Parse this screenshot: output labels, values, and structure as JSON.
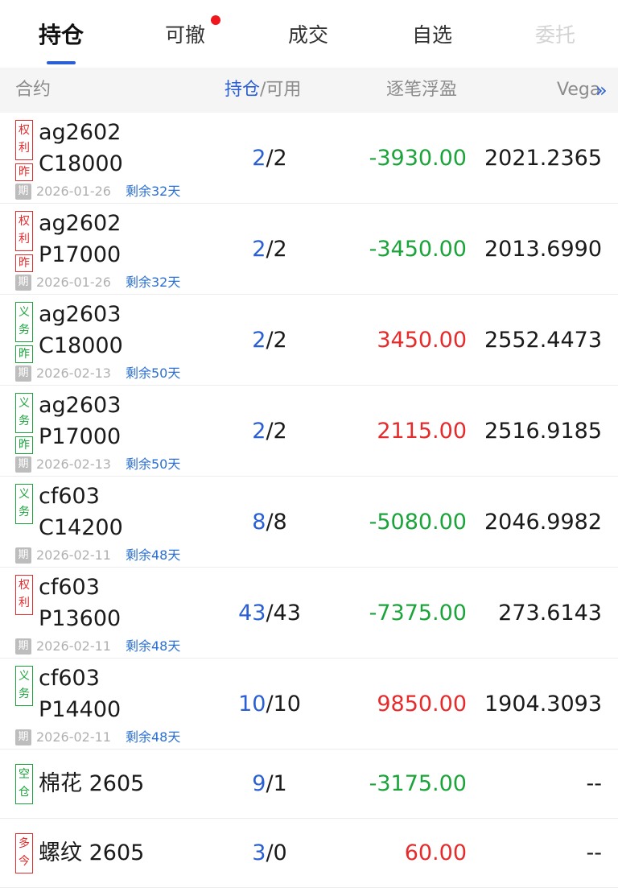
{
  "tabs": [
    {
      "label": "持仓",
      "active": true
    },
    {
      "label": "可撤",
      "badge": true
    },
    {
      "label": "成交"
    },
    {
      "label": "自选"
    },
    {
      "label": "委托",
      "faded": true
    }
  ],
  "header": {
    "contract": "合约",
    "held": "持仓",
    "sep_available": "/可用",
    "pnl": "逐笔浮盈",
    "vega": "Vega",
    "more_icon": "double-chevron-right-icon"
  },
  "colors": {
    "accent": "#2a5fd6",
    "loss": "#1aa43a",
    "gain": "#e52b2b",
    "badge": "#f0161e"
  },
  "rows": [
    {
      "tag1": "权利",
      "tag2": "昨",
      "tagColor": "red",
      "line1": "ag2602",
      "line2": "C18000",
      "qi": "期",
      "date": "2026-01-26",
      "remain": "剩余32天",
      "held": "2",
      "avail": "/2",
      "pnl": "-3930.00",
      "pnlType": "neg",
      "vega": "2021.2365"
    },
    {
      "tag1": "权利",
      "tag2": "昨",
      "tagColor": "red",
      "line1": "ag2602",
      "line2": "P17000",
      "qi": "期",
      "date": "2026-01-26",
      "remain": "剩余32天",
      "held": "2",
      "avail": "/2",
      "pnl": "-3450.00",
      "pnlType": "neg",
      "vega": "2013.6990"
    },
    {
      "tag1": "义务",
      "tag2": "昨",
      "tagColor": "green",
      "line1": "ag2603",
      "line2": "C18000",
      "qi": "期",
      "date": "2026-02-13",
      "remain": "剩余50天",
      "held": "2",
      "avail": "/2",
      "pnl": "3450.00",
      "pnlType": "pos",
      "vega": "2552.4473"
    },
    {
      "tag1": "义务",
      "tag2": "昨",
      "tagColor": "green",
      "line1": "ag2603",
      "line2": "P17000",
      "qi": "期",
      "date": "2026-02-13",
      "remain": "剩余50天",
      "held": "2",
      "avail": "/2",
      "pnl": "2115.00",
      "pnlType": "pos",
      "vega": "2516.9185"
    },
    {
      "tag1": "义务",
      "tag2": "",
      "tagColor": "green",
      "line1": "cf603",
      "line2": "C14200",
      "qi": "期",
      "date": "2026-02-11",
      "remain": "剩余48天",
      "held": "8",
      "avail": "/8",
      "pnl": "-5080.00",
      "pnlType": "neg",
      "vega": "2046.9982"
    },
    {
      "tag1": "权利",
      "tag2": "",
      "tagColor": "red",
      "line1": "cf603",
      "line2": "P13600",
      "qi": "期",
      "date": "2026-02-11",
      "remain": "剩余48天",
      "held": "43",
      "avail": "/43",
      "pnl": "-7375.00",
      "pnlType": "neg",
      "vega": "273.6143"
    },
    {
      "tag1": "义务",
      "tag2": "",
      "tagColor": "green",
      "line1": "cf603",
      "line2": "P14400",
      "qi": "期",
      "date": "2026-02-11",
      "remain": "剩余48天",
      "held": "10",
      "avail": "/10",
      "pnl": "9850.00",
      "pnlType": "pos",
      "vega": "1904.3093"
    },
    {
      "tag1": "空仓",
      "tagColor": "green",
      "line1": "棉花 2605",
      "held": "9",
      "avail": "/1",
      "pnl": "-3175.00",
      "pnlType": "neg",
      "vega": "--"
    },
    {
      "tag1": "多今",
      "tagColor": "red",
      "line1": "螺纹 2605",
      "held": "3",
      "avail": "/0",
      "pnl": "60.00",
      "pnlType": "pos",
      "vega": "--"
    }
  ]
}
